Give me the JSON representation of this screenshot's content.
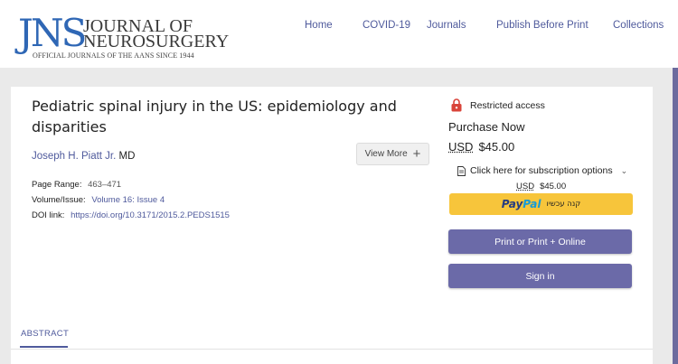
{
  "header": {
    "logo": {
      "mark": "JNS",
      "line1": "JOURNAL OF",
      "line2": "NEUROSURGERY",
      "tagline": "OFFICIAL JOURNALS OF THE AANS SINCE 1944"
    },
    "nav": [
      {
        "label": "Home"
      },
      {
        "label": "COVID-19"
      },
      {
        "label": "Journals"
      },
      {
        "label": "Publish Before Print"
      },
      {
        "label": "Collections"
      }
    ]
  },
  "article": {
    "title": "Pediatric spinal injury in the US: epidemiology and disparities",
    "author_name": "Joseph H. Piatt Jr.",
    "author_suffix": "MD",
    "view_more_label": "View More",
    "page_range_label": "Page Range:",
    "page_range_value": "463–471",
    "volume_label": "Volume/Issue:",
    "volume_value": "Volume 16: Issue 4",
    "doi_label": "DOI link:",
    "doi_value": "https://doi.org/10.3171/2015.2.PEDS1515"
  },
  "access": {
    "restricted_label": "Restricted access",
    "purchase_label": "Purchase Now",
    "currency": "USD",
    "price": "$45.00",
    "subscription_label": "Click here for subscription options",
    "sub_currency": "USD",
    "sub_price": "$45.00",
    "paypal_pay": "Pay",
    "paypal_pal": "Pal",
    "paypal_text": "קנה עכשיו",
    "print_button": "Print or Print + Online",
    "signin_button": "Sign in"
  },
  "tabs": {
    "abstract": "ABSTRACT"
  },
  "colors": {
    "accent": "#4f5a9c",
    "button": "#6b6aa8",
    "paypal_yellow": "#f7c53b",
    "logo_blue": "#2f67b5",
    "lock_red": "#d9443a"
  }
}
